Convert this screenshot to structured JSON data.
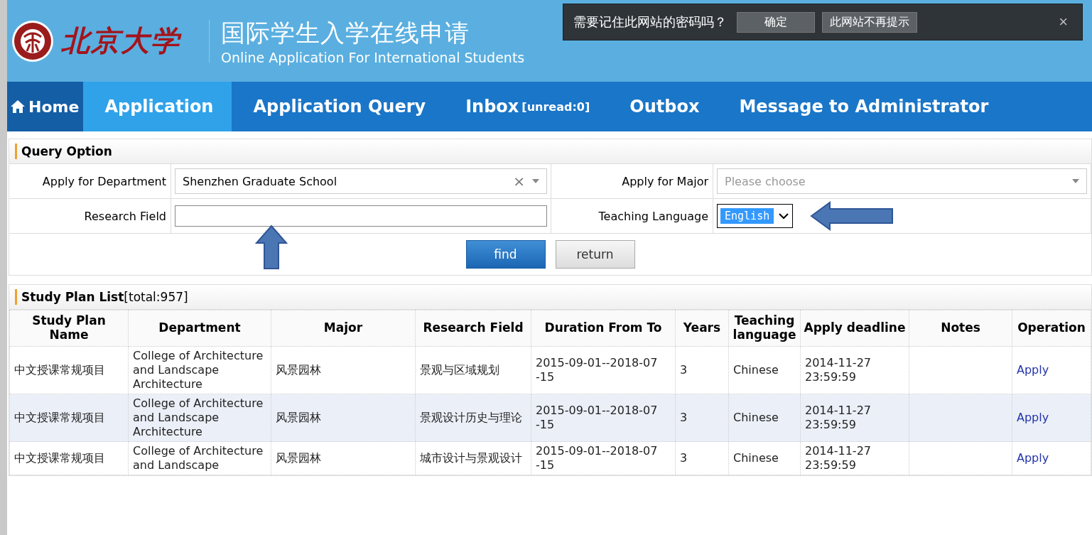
{
  "header": {
    "university": "北京大学",
    "title": "国际学生入学在线申请",
    "subtitle": "Online Application For International Students"
  },
  "password_prompt": {
    "message": "需要记住此网站的密码吗？",
    "buttons": [
      "确定",
      "此网站不再提示"
    ],
    "close": "×"
  },
  "nav": [
    {
      "label": "Home",
      "kind": "home",
      "selected": false
    },
    {
      "label": "Application",
      "kind": "link",
      "selected": true
    },
    {
      "label": "Application Query",
      "kind": "link",
      "selected": false
    },
    {
      "label": "Inbox",
      "suffix": "[unread:0]",
      "kind": "link",
      "selected": false
    },
    {
      "label": "Outbox",
      "kind": "link",
      "selected": false
    },
    {
      "label": "Message to Administrator",
      "kind": "link",
      "selected": false
    }
  ],
  "query": {
    "title": "Query Option",
    "department_label": "Apply for Department",
    "department_value": "Shenzhen Graduate School",
    "clear": "×",
    "major_label": "Apply for Major",
    "major_placeholder": "Please choose",
    "field_label": "Research Field",
    "language_label": "Teaching Language",
    "language_value": "English",
    "buttons": [
      "find",
      "return"
    ]
  },
  "list": {
    "title": "Study Plan List",
    "total": "[total:957]",
    "columns": [
      "Study Plan Name",
      "Department",
      "Major",
      "Research Field",
      "Duration From To",
      "Years",
      "Teaching language",
      "Apply deadline",
      "Notes",
      "Operation"
    ],
    "rows": [
      {
        "cells": [
          "中文授课常规项目",
          "College of Architecture and Landscape Architecture",
          "风景园林",
          "景观与区域规划",
          "2015-09-01--2018-07 -15",
          "3",
          "Chinese",
          "2014-11-27 23:59:59",
          ""
        ],
        "action": "Apply",
        "selected": false
      },
      {
        "cells": [
          "中文授课常规项目",
          "College of Architecture and Landscape Architecture",
          "风景园林",
          "景观设计历史与理论",
          "2015-09-01--2018-07 -15",
          "3",
          "Chinese",
          "2014-11-27 23:59:59",
          ""
        ],
        "action": "Apply",
        "selected": true
      },
      {
        "cells": [
          "中文授课常规项目",
          "College of Architecture and Landscape",
          "风景园林",
          "城市设计与景观设计",
          "2015-09-01--2018-07 -15",
          "3",
          "Chinese",
          "2014-11-27 23:59:59",
          ""
        ],
        "action": "Apply",
        "selected": false
      }
    ]
  }
}
